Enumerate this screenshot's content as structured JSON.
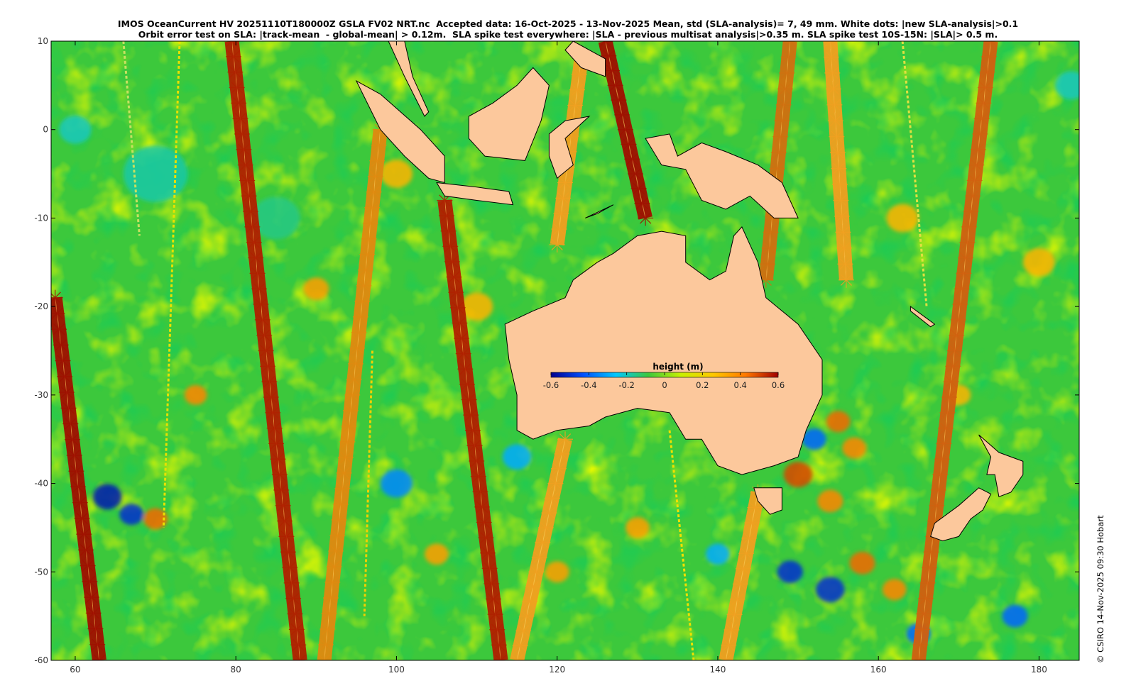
{
  "title_line_1": "IMOS OceanCurrent HV 20251110T180000Z GSLA FV02 NRT.nc  Accepted data: 16-Oct-2025 - 13-Nov-2025 Mean, std (SLA-analysis)= 7, 49 mm. White dots: |new SLA-analysis|>0.1",
  "title_line_2": "Orbit error test on SLA: |track-mean  - global-mean| > 0.12m.  SLA spike test everywhere: |SLA - previous multisat analysis|>0.35 m. SLA spike test 10S-15N: |SLA|> 0.5 m.",
  "credit": "© CSIRO 14-Nov-2025 09:30 Hobart",
  "map": {
    "lon_range": [
      57,
      185
    ],
    "lat_range": [
      -60,
      10
    ],
    "x_ticks": [
      60,
      80,
      100,
      120,
      140,
      160,
      180
    ],
    "y_ticks": [
      10,
      0,
      -10,
      -20,
      -30,
      -40,
      -50,
      -60
    ],
    "land_color": "#fcc89c",
    "ocean_base_color": "#3cc83c"
  },
  "colorbar": {
    "label": "height (m)",
    "range": [
      -0.6,
      0.6
    ],
    "ticks": [
      "-0.6",
      "-0.4",
      "-0.2",
      "0",
      "0.2",
      "0.4",
      "0.6"
    ],
    "colors": [
      "#00008f",
      "#0050ff",
      "#00c8ff",
      "#3cc83c",
      "#c8f000",
      "#ffc800",
      "#ff7800",
      "#a00000"
    ]
  },
  "tracks": [
    {
      "lon_top": 57.5,
      "lat_top": -19,
      "lon_bot": 63,
      "lat_bot": -60,
      "color": "#a01000"
    },
    {
      "lon_top": 79.5,
      "lat_top": 10,
      "lon_bot": 88,
      "lat_bot": -60,
      "color": "#b02000"
    },
    {
      "lon_top": 98,
      "lat_top": 0,
      "lon_bot": 91,
      "lat_bot": -60,
      "color": "#e08a10"
    },
    {
      "lon_top": 106,
      "lat_top": -8,
      "lon_bot": 113,
      "lat_bot": -60,
      "color": "#b02000"
    },
    {
      "lon_top": 126,
      "lat_top": 10,
      "lon_bot": 131,
      "lat_bot": -10,
      "color": "#a01000"
    },
    {
      "lon_top": 123,
      "lat_top": 8,
      "lon_bot": 120,
      "lat_bot": -13,
      "color": "#f0a020"
    },
    {
      "lon_top": 121,
      "lat_top": -35,
      "lon_bot": 115,
      "lat_bot": -60,
      "color": "#f0a020"
    },
    {
      "lon_top": 149,
      "lat_top": 10,
      "lon_bot": 146,
      "lat_bot": -17,
      "color": "#d07010"
    },
    {
      "lon_top": 145,
      "lat_top": -41,
      "lon_bot": 141,
      "lat_bot": -60,
      "color": "#f0a020"
    },
    {
      "lon_top": 154,
      "lat_top": 10,
      "lon_bot": 156,
      "lat_bot": -17,
      "color": "#f0a020"
    },
    {
      "lon_top": 174,
      "lat_top": 10,
      "lon_bot": 165,
      "lat_bot": -60,
      "color": "#d06010"
    }
  ],
  "thin_tracks": [
    {
      "lon_top": 66,
      "lat_top": 10,
      "lon_bot": 68,
      "lat_bot": -12,
      "color": "#c8e060"
    },
    {
      "lon_top": 73,
      "lat_top": 10,
      "lon_bot": 71,
      "lat_bot": -45,
      "color": "#e8e000"
    },
    {
      "lon_top": 97,
      "lat_top": -25,
      "lon_bot": 96,
      "lat_bot": -55,
      "color": "#f0d000"
    },
    {
      "lon_top": 134,
      "lat_top": -34,
      "lon_bot": 137,
      "lat_bot": -60,
      "color": "#f0e000"
    },
    {
      "lon_top": 163,
      "lat_top": 10,
      "lon_bot": 166,
      "lat_bot": -20,
      "color": "#e0e040"
    }
  ],
  "land": [
    {
      "name": "australia",
      "points": [
        [
          113.5,
          -22
        ],
        [
          114,
          -26
        ],
        [
          115,
          -30
        ],
        [
          115,
          -34
        ],
        [
          117,
          -35
        ],
        [
          120,
          -34
        ],
        [
          124,
          -33.5
        ],
        [
          126,
          -32.5
        ],
        [
          130,
          -31.5
        ],
        [
          134,
          -32
        ],
        [
          136,
          -35
        ],
        [
          138,
          -35
        ],
        [
          140,
          -38
        ],
        [
          143,
          -39
        ],
        [
          145,
          -38.5
        ],
        [
          147,
          -38
        ],
        [
          150,
          -37
        ],
        [
          151,
          -34
        ],
        [
          153,
          -30
        ],
        [
          153,
          -26
        ],
        [
          150,
          -22
        ],
        [
          146,
          -19
        ],
        [
          145,
          -15
        ],
        [
          143,
          -11
        ],
        [
          142,
          -12
        ],
        [
          141,
          -16
        ],
        [
          139,
          -17
        ],
        [
          136,
          -15
        ],
        [
          136,
          -12
        ],
        [
          133,
          -11.5
        ],
        [
          130,
          -12
        ],
        [
          127,
          -14
        ],
        [
          125,
          -15
        ],
        [
          122,
          -17
        ],
        [
          121,
          -19
        ],
        [
          117,
          -20.5
        ]
      ]
    },
    {
      "name": "tasmania",
      "points": [
        [
          144.5,
          -40.5
        ],
        [
          148,
          -40.5
        ],
        [
          148,
          -43
        ],
        [
          146.5,
          -43.5
        ],
        [
          145,
          -42
        ]
      ]
    },
    {
      "name": "new-guinea",
      "points": [
        [
          131,
          -1
        ],
        [
          134,
          -0.5
        ],
        [
          135,
          -3
        ],
        [
          138,
          -1.5
        ],
        [
          141,
          -2.5
        ],
        [
          145,
          -4
        ],
        [
          148,
          -6
        ],
        [
          150,
          -10
        ],
        [
          147,
          -10
        ],
        [
          144,
          -7.5
        ],
        [
          141,
          -9
        ],
        [
          138,
          -8
        ],
        [
          136,
          -4.5
        ],
        [
          133,
          -4
        ]
      ]
    },
    {
      "name": "borneo",
      "points": [
        [
          109,
          1.5
        ],
        [
          112,
          3
        ],
        [
          115,
          5
        ],
        [
          117,
          7
        ],
        [
          119,
          5
        ],
        [
          118,
          1
        ],
        [
          116,
          -3.5
        ],
        [
          111,
          -3
        ],
        [
          109,
          -1
        ]
      ]
    },
    {
      "name": "sumatra",
      "points": [
        [
          95,
          5.5
        ],
        [
          98,
          4
        ],
        [
          103,
          0
        ],
        [
          106,
          -3
        ],
        [
          106,
          -6
        ],
        [
          104,
          -5.5
        ],
        [
          101,
          -3
        ],
        [
          98,
          0
        ]
      ]
    },
    {
      "name": "java",
      "points": [
        [
          105,
          -6
        ],
        [
          110,
          -6.5
        ],
        [
          114,
          -7
        ],
        [
          114.5,
          -8.5
        ],
        [
          110,
          -8
        ],
        [
          106,
          -7.5
        ]
      ]
    },
    {
      "name": "sulawesi",
      "points": [
        [
          119,
          -0.5
        ],
        [
          121,
          1
        ],
        [
          124,
          1.5
        ],
        [
          121,
          -1
        ],
        [
          122,
          -4
        ],
        [
          120,
          -5.5
        ],
        [
          119,
          -3
        ]
      ]
    },
    {
      "name": "malay-peninsula",
      "points": [
        [
          99,
          10
        ],
        [
          101,
          6
        ],
        [
          103.5,
          1.5
        ],
        [
          104,
          2
        ],
        [
          102,
          6
        ],
        [
          101,
          10
        ]
      ]
    },
    {
      "name": "philippines",
      "points": [
        [
          122,
          10
        ],
        [
          126,
          8
        ],
        [
          126,
          6
        ],
        [
          123,
          7
        ],
        [
          121,
          9
        ]
      ]
    },
    {
      "name": "timor",
      "points": [
        [
          123.5,
          -10
        ],
        [
          127,
          -8.5
        ],
        [
          125,
          -9.5
        ]
      ]
    },
    {
      "name": "nz-north",
      "points": [
        [
          172.5,
          -34.5
        ],
        [
          175,
          -36.5
        ],
        [
          178,
          -37.5
        ],
        [
          178,
          -39
        ],
        [
          176.5,
          -41
        ],
        [
          175,
          -41.5
        ],
        [
          174.5,
          -39
        ],
        [
          173.5,
          -39
        ],
        [
          174,
          -37
        ]
      ]
    },
    {
      "name": "nz-south",
      "points": [
        [
          172.5,
          -40.5
        ],
        [
          174,
          -41.2
        ],
        [
          173,
          -43
        ],
        [
          171.5,
          -44
        ],
        [
          170,
          -46
        ],
        [
          168,
          -46.5
        ],
        [
          166.5,
          -46
        ],
        [
          167,
          -44.5
        ],
        [
          170,
          -42.5
        ]
      ]
    },
    {
      "name": "new-caledonia",
      "points": [
        [
          164,
          -20
        ],
        [
          167,
          -22
        ],
        [
          166.5,
          -22.3
        ],
        [
          164,
          -20.5
        ]
      ]
    }
  ],
  "blobs": [
    {
      "lon": 64,
      "lat": -41.5,
      "r": 1.8,
      "v": -0.55
    },
    {
      "lon": 67,
      "lat": -43.5,
      "r": 1.5,
      "v": -0.5
    },
    {
      "lon": 70,
      "lat": -44,
      "r": 1.5,
      "v": 0.45
    },
    {
      "lon": 100,
      "lat": -40,
      "r": 2.0,
      "v": -0.35
    },
    {
      "lon": 115,
      "lat": -37,
      "r": 1.8,
      "v": -0.3
    },
    {
      "lon": 150,
      "lat": -39,
      "r": 1.8,
      "v": 0.5
    },
    {
      "lon": 152,
      "lat": -35,
      "r": 1.5,
      "v": -0.4
    },
    {
      "lon": 155,
      "lat": -33,
      "r": 1.5,
      "v": 0.45
    },
    {
      "lon": 157,
      "lat": -36,
      "r": 1.5,
      "v": 0.4
    },
    {
      "lon": 154,
      "lat": -42,
      "r": 1.6,
      "v": 0.4
    },
    {
      "lon": 149,
      "lat": -50,
      "r": 1.6,
      "v": -0.5
    },
    {
      "lon": 154,
      "lat": -52,
      "r": 1.8,
      "v": -0.5
    },
    {
      "lon": 158,
      "lat": -49,
      "r": 1.6,
      "v": 0.45
    },
    {
      "lon": 162,
      "lat": -52,
      "r": 1.5,
      "v": 0.4
    },
    {
      "lon": 177,
      "lat": -55,
      "r": 1.6,
      "v": -0.4
    },
    {
      "lon": 140,
      "lat": -48,
      "r": 1.5,
      "v": -0.3
    },
    {
      "lon": 165,
      "lat": -57,
      "r": 1.5,
      "v": -0.4
    },
    {
      "lon": 90,
      "lat": -18,
      "r": 1.6,
      "v": 0.35
    },
    {
      "lon": 85,
      "lat": -10,
      "r": 3.0,
      "v": -0.15
    },
    {
      "lon": 70,
      "lat": -5,
      "r": 4.0,
      "v": -0.18
    },
    {
      "lon": 110,
      "lat": -20,
      "r": 2.0,
      "v": 0.3
    },
    {
      "lon": 100,
      "lat": -5,
      "r": 2.0,
      "v": 0.3
    },
    {
      "lon": 163,
      "lat": -10,
      "r": 2.0,
      "v": 0.3
    },
    {
      "lon": 180,
      "lat": -15,
      "r": 2.0,
      "v": 0.3
    },
    {
      "lon": 60,
      "lat": 0,
      "r": 2.0,
      "v": -0.2
    },
    {
      "lon": 184,
      "lat": 5,
      "r": 2.0,
      "v": -0.2
    },
    {
      "lon": 75,
      "lat": -30,
      "r": 1.4,
      "v": 0.4
    },
    {
      "lon": 130,
      "lat": -45,
      "r": 1.5,
      "v": 0.35
    },
    {
      "lon": 120,
      "lat": -50,
      "r": 1.5,
      "v": 0.35
    },
    {
      "lon": 105,
      "lat": -48,
      "r": 1.5,
      "v": 0.35
    },
    {
      "lon": 170,
      "lat": -30,
      "r": 1.5,
      "v": 0.3
    }
  ]
}
